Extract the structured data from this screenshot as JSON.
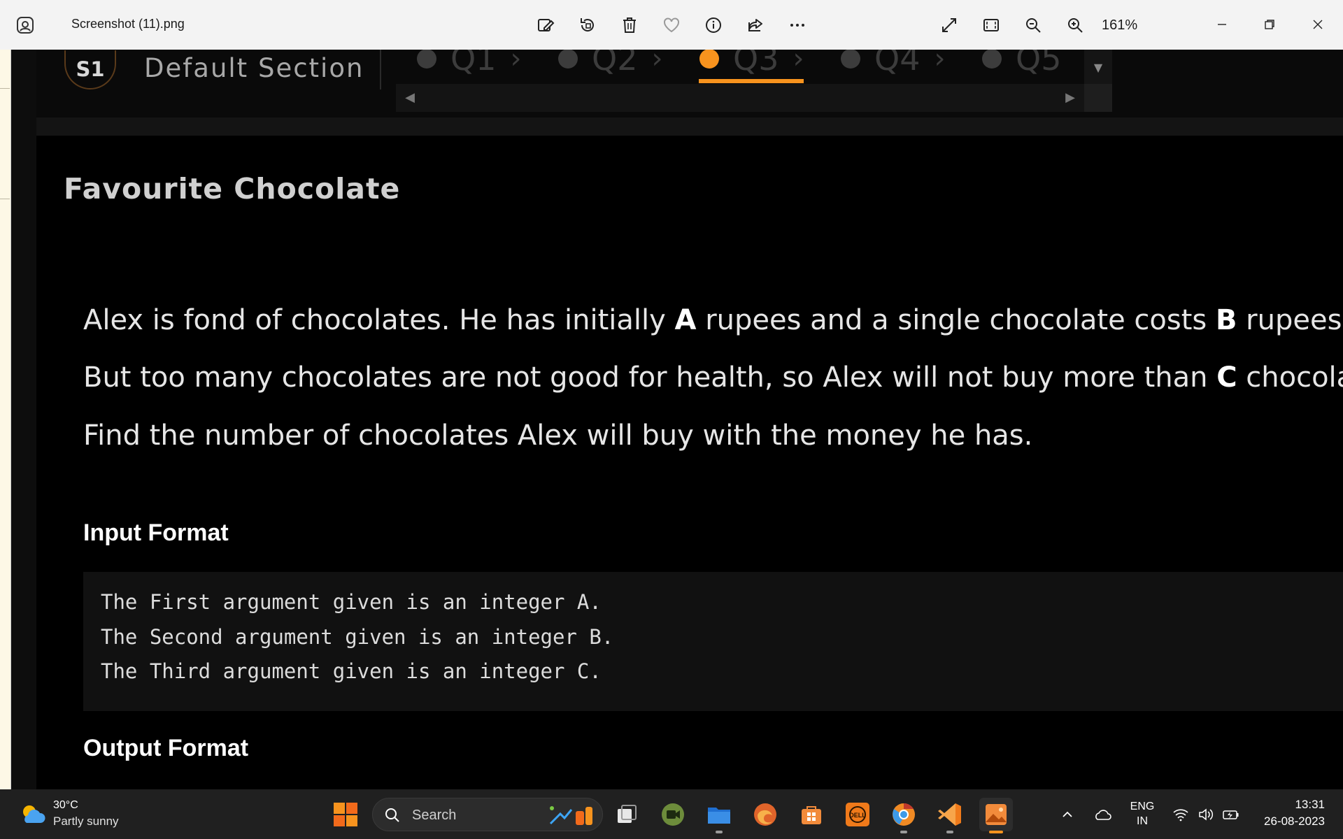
{
  "window": {
    "file_name": "Screenshot (11).png",
    "zoom_level": "161%",
    "toolbar_icons": [
      "edit-image-icon",
      "rotate-icon",
      "delete-icon",
      "favorite-icon",
      "info-icon",
      "share-icon",
      "more-icon"
    ],
    "view_icons": [
      "fullscreen-icon",
      "fit-to-window-icon",
      "zoom-out-icon",
      "zoom-in-icon"
    ],
    "window_controls": [
      "minimize-icon",
      "maximize-icon",
      "close-icon"
    ]
  },
  "test": {
    "section_badge": "S1",
    "section_name": "Default Section",
    "questions": [
      {
        "label": "Q1",
        "active": false
      },
      {
        "label": "Q2",
        "active": false
      },
      {
        "label": "Q3",
        "active": true
      },
      {
        "label": "Q4",
        "active": false
      },
      {
        "label": "Q5",
        "active": false
      }
    ],
    "accent_color": "#f7931e"
  },
  "problem": {
    "title": "Favourite Chocolate",
    "para1": {
      "t1": "Alex is fond of chocolates. He has initially ",
      "b1": "A",
      "t2": " rupees and a single chocolate costs ",
      "b2": "B",
      "t3": " rupees."
    },
    "para2": {
      "t1": "But too many chocolates are not good for health, so Alex will not buy more than ",
      "b1": "C",
      "t2": " chocolates."
    },
    "para3": "Find the number of chocolates Alex will buy with the money he has.",
    "input_heading": "Input Format",
    "input_lines": [
      "The First argument given is an integer A.",
      "The Second argument given is an integer B.",
      "The Third argument given is an integer C."
    ],
    "output_heading": "Output Format"
  },
  "taskbar": {
    "weather_temp": "30°C",
    "weather_desc": "Partly sunny",
    "search_placeholder": "Search",
    "language_line1": "ENG",
    "language_line2": "IN",
    "time": "13:31",
    "date": "26-08-2023",
    "apps": [
      "windows-start-icon",
      "task-view-icon",
      "meet-icon",
      "file-explorer-icon",
      "edge-icon",
      "microsoft-store-icon",
      "dell-icon",
      "chrome-icon",
      "vscode-icon",
      "photos-icon"
    ]
  }
}
